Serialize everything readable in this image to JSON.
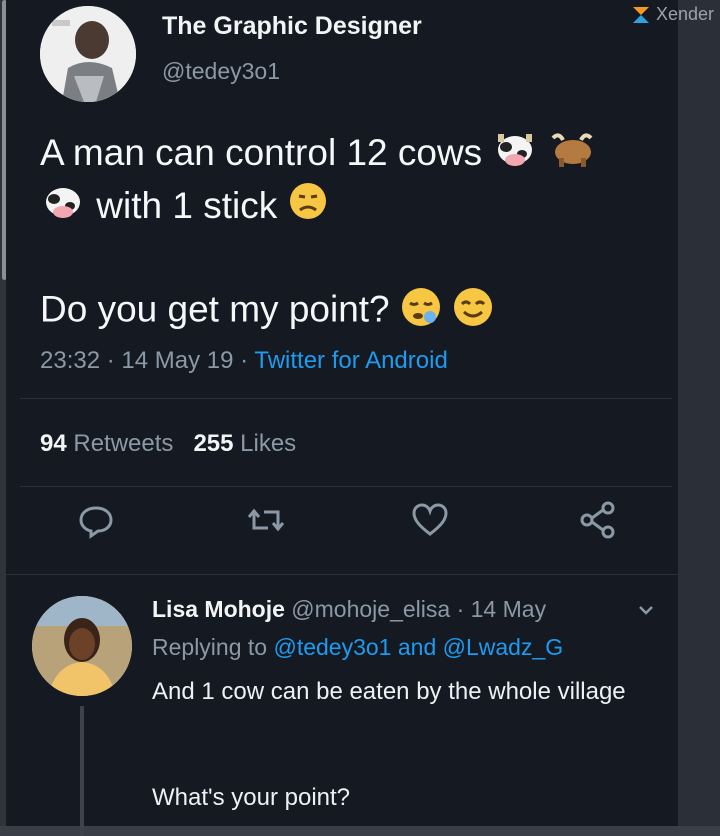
{
  "watermark": {
    "label": "Xender",
    "icon": "xender-logo-icon"
  },
  "tweet": {
    "display_name": "The Graphic Designer",
    "handle": "@tedey3o1",
    "text_line1": "A man can control 12 cows",
    "text_line2": "with 1 stick",
    "text_para2": "Do you get my point?",
    "time": "23:32",
    "sep1": " · ",
    "date": "14 May 19",
    "sep2": " · ",
    "source": "Twitter for Android",
    "retweets_count": "94",
    "retweets_label": "Retweets",
    "likes_count": "255",
    "likes_label": "Likes",
    "emojis": [
      "cow-face-emoji",
      "ox-emoji",
      "cow-face-emoji",
      "disappointed-face-emoji",
      "sleepy-face-emoji",
      "relieved-face-emoji"
    ]
  },
  "actions": [
    "reply-icon",
    "retweet-icon",
    "like-icon",
    "share-icon"
  ],
  "reply": {
    "display_name": "Lisa Mohoje",
    "handle": "@mohoje_elisa",
    "sep": " · ",
    "date": "14 May",
    "replying_to_label": "Replying to",
    "mention1": "@tedey3o1",
    "and_label": "and",
    "mention2": "@Lwadz_G",
    "text": "And 1 cow can be eaten by the whole village",
    "text2": "What's your point?"
  },
  "colors": {
    "background": "#151a22",
    "link": "#1d9bf0",
    "muted": "#8b98a5",
    "text": "#f5f7f9"
  }
}
